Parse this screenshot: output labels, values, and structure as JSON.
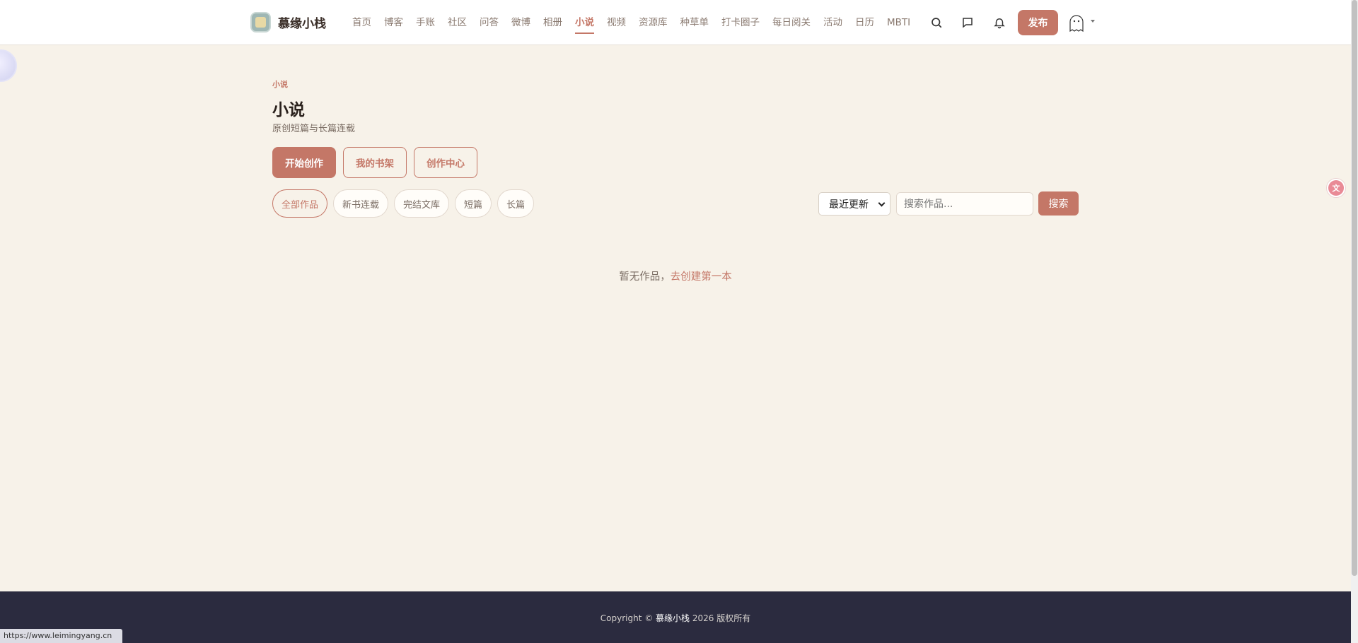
{
  "header": {
    "brand_name": "慕缘小栈",
    "nav": [
      {
        "label": "首页"
      },
      {
        "label": "博客"
      },
      {
        "label": "手账"
      },
      {
        "label": "社区"
      },
      {
        "label": "问答"
      },
      {
        "label": "微博"
      },
      {
        "label": "相册"
      },
      {
        "label": "小说",
        "active": true
      },
      {
        "label": "视频"
      },
      {
        "label": "资源库"
      },
      {
        "label": "种草单"
      },
      {
        "label": "打卡圈子"
      },
      {
        "label": "每日阅关"
      },
      {
        "label": "活动"
      },
      {
        "label": "日历"
      },
      {
        "label": "MBTI"
      }
    ],
    "publish_label": "发布",
    "icons": [
      "search-icon",
      "message-icon",
      "bell-icon",
      "avatar",
      "chevron-down-icon"
    ]
  },
  "main": {
    "kicker": "小说",
    "title": "小说",
    "subtitle": "原创短篇与长篇连载",
    "actions": [
      {
        "label": "开始创作",
        "style": "primary"
      },
      {
        "label": "我的书架",
        "style": "outline"
      },
      {
        "label": "创作中心",
        "style": "outline"
      }
    ],
    "filters": [
      {
        "label": "全部作品",
        "active": true
      },
      {
        "label": "新书连载"
      },
      {
        "label": "完结文库"
      },
      {
        "label": "短篇"
      },
      {
        "label": "长篇"
      }
    ],
    "sort": {
      "selected": "最近更新"
    },
    "search": {
      "placeholder": "搜索作品...",
      "button_label": "搜索"
    },
    "empty": {
      "text": "暂无作品，",
      "link": "去创建第一本"
    }
  },
  "footer": {
    "copyright_prefix": "Copyright © ",
    "copyright_brand": "慕缘小栈",
    "copyright_suffix": " 2026 版权所有"
  },
  "status_bar": {
    "url": "https://www.leimingyang.cn"
  },
  "colors": {
    "accent": "#c47767",
    "background": "#f7f2e9",
    "footer": "#2b2b3f"
  }
}
